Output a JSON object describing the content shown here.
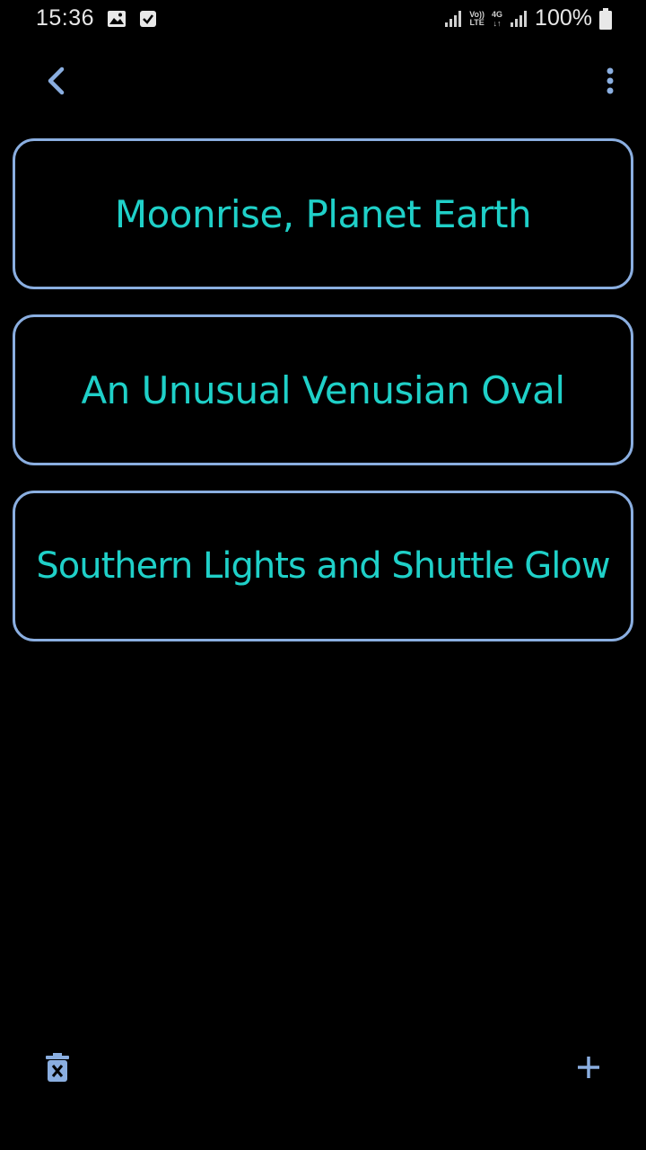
{
  "status_bar": {
    "time": "15:36",
    "volte_top": "Vo))",
    "volte_bottom": "LTE",
    "network_top": "4G",
    "network_bottom": "↓↑",
    "battery": "100%"
  },
  "toolbar": {
    "back_icon": "chevron-left-icon",
    "menu_icon": "more-vert-icon"
  },
  "items": [
    {
      "title": "Moonrise, Planet Earth"
    },
    {
      "title": "An Unusual Venusian Oval"
    },
    {
      "title": "Southern Lights and Shuttle Glow"
    }
  ],
  "bottom_bar": {
    "delete_icon": "delete-forever-icon",
    "add_icon": "plus-icon"
  },
  "colors": {
    "background": "#000000",
    "accent_text": "#1fd0c8",
    "card_border": "#8aaee0",
    "icon": "#8aaee0"
  }
}
